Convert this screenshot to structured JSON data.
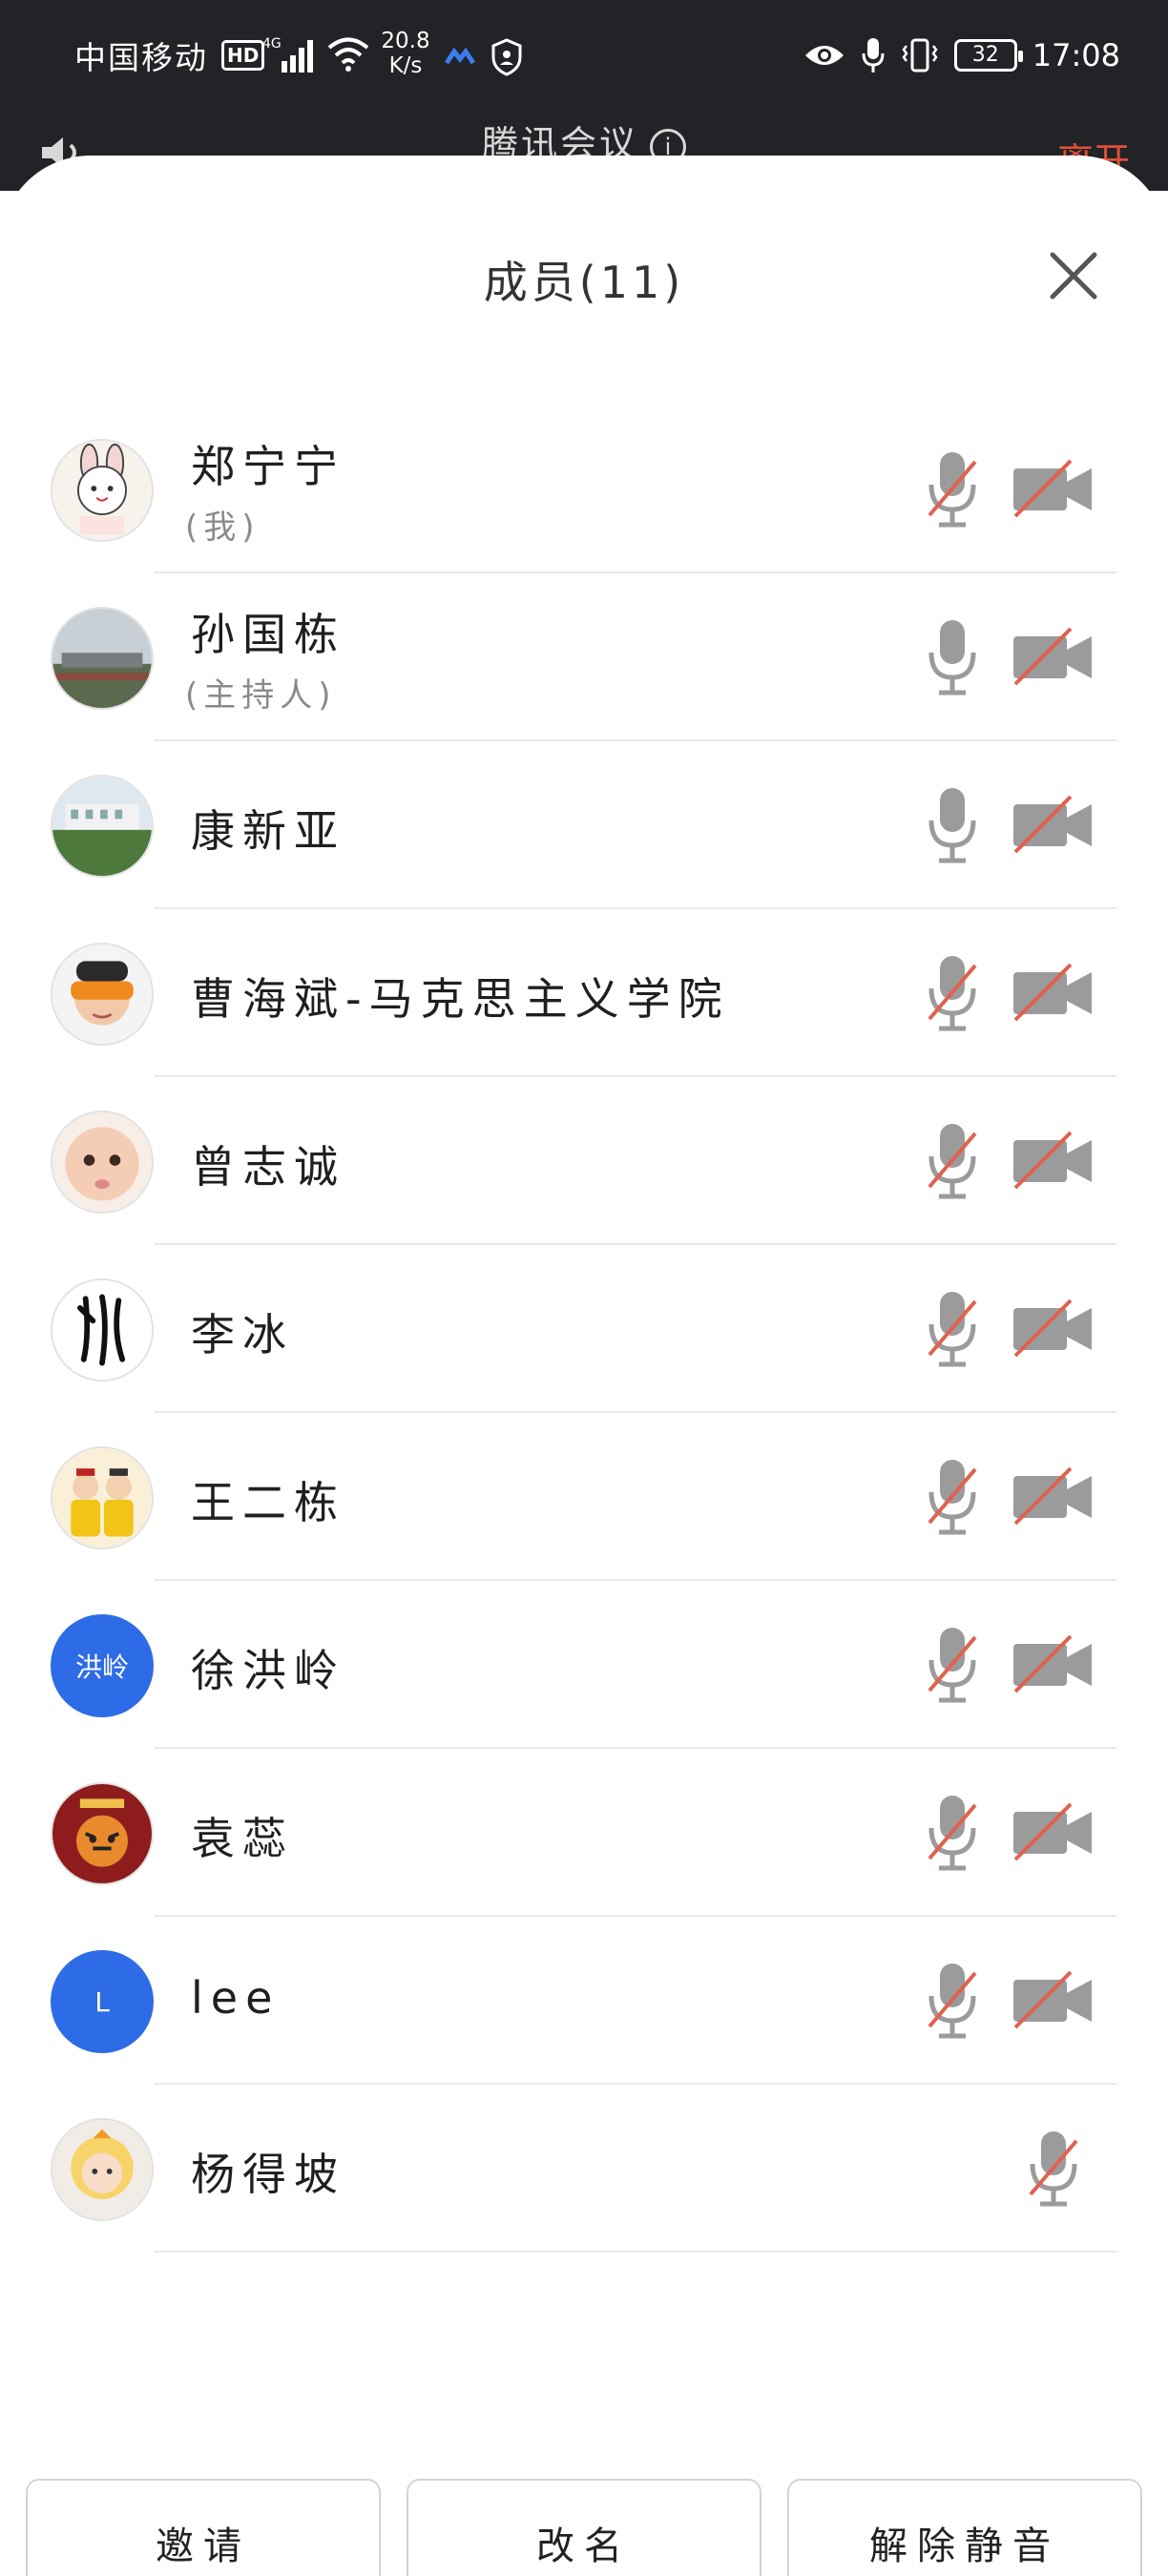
{
  "status_bar": {
    "carrier": "中国移动",
    "hd_badge": "HD",
    "network_type": "4G",
    "speed_value": "20.8",
    "speed_unit": "K/s",
    "battery": "32",
    "time": "17:08"
  },
  "meeting_header": {
    "title": "腾讯会议",
    "end_label": "离开"
  },
  "sheet": {
    "title": "成员(11)"
  },
  "members": [
    {
      "name": "郑宁宁",
      "role": "(我)",
      "avatar_text": "",
      "mic_muted": true,
      "has_camera": true,
      "camera_off": true
    },
    {
      "name": "孙国栋",
      "role": "(主持人)",
      "avatar_text": "",
      "mic_muted": false,
      "has_camera": true,
      "camera_off": true
    },
    {
      "name": "康新亚",
      "role": "",
      "avatar_text": "",
      "mic_muted": false,
      "has_camera": true,
      "camera_off": true
    },
    {
      "name": "曹海斌-马克思主义学院",
      "role": "",
      "avatar_text": "",
      "mic_muted": true,
      "has_camera": true,
      "camera_off": true
    },
    {
      "name": "曾志诚",
      "role": "",
      "avatar_text": "",
      "mic_muted": true,
      "has_camera": true,
      "camera_off": true
    },
    {
      "name": "李冰",
      "role": "",
      "avatar_text": "",
      "mic_muted": true,
      "has_camera": true,
      "camera_off": true
    },
    {
      "name": "王二栋",
      "role": "",
      "avatar_text": "",
      "mic_muted": true,
      "has_camera": true,
      "camera_off": true
    },
    {
      "name": "徐洪岭",
      "role": "",
      "avatar_text": "洪岭",
      "mic_muted": true,
      "has_camera": true,
      "camera_off": true
    },
    {
      "name": "袁蕊",
      "role": "",
      "avatar_text": "",
      "mic_muted": true,
      "has_camera": true,
      "camera_off": true
    },
    {
      "name": "lee",
      "role": "",
      "avatar_text": "L",
      "mic_muted": true,
      "has_camera": true,
      "camera_off": true
    },
    {
      "name": "杨得坡",
      "role": "",
      "avatar_text": "",
      "mic_muted": true,
      "has_camera": false,
      "camera_off": true
    }
  ],
  "actions": {
    "invite": "邀请",
    "rename": "改名",
    "unmute": "解除静音"
  },
  "colors": {
    "mute_slash": "#e0614f",
    "icon_gray": "#9b9b9b",
    "avatar_blue": "#2e6be6",
    "header_bg": "#222326"
  },
  "icons": {
    "close": "close-icon",
    "mic": "microphone-icon",
    "camera": "camera-icon"
  }
}
